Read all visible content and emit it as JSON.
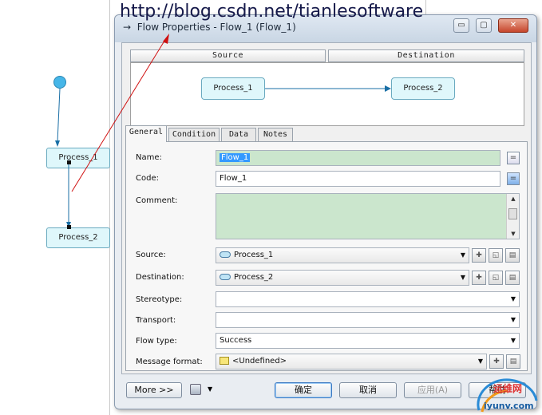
{
  "watermark": "http://blog.csdn.net/tianlesoftware",
  "background": {
    "nodes": [
      "Process_1",
      "Process_2"
    ]
  },
  "dialog": {
    "title": "Flow Properties - Flow_1 (Flow_1)",
    "title_icon": "→",
    "window_buttons": {
      "minimize": "▭",
      "maximize": "▢",
      "close": "✕"
    },
    "preview": {
      "source_header": "Source",
      "destination_header": "Destination",
      "source_node": "Process_1",
      "destination_node": "Process_2"
    },
    "tabs": [
      "General",
      "Condition",
      "Data",
      "Notes"
    ],
    "form": {
      "name_label": "Name:",
      "name_value": "Flow_1",
      "code_label": "Code:",
      "code_value": "Flow_1",
      "comment_label": "Comment:",
      "source_label": "Source:",
      "source_value": "Process_1",
      "destination_label": "Destination:",
      "destination_value": "Process_2",
      "stereotype_label": "Stereotype:",
      "transport_label": "Transport:",
      "flow_type_label": "Flow type:",
      "flow_type_value": "Success",
      "message_format_label": "Message format:",
      "message_format_value": "<Undefined>",
      "equals_button": "="
    },
    "buttons": {
      "more": "More >>",
      "ok": "确定",
      "cancel": "取消",
      "apply": "应用(A)",
      "help": "帮助"
    }
  },
  "logo": {
    "text_top": "运维网",
    "text_bottom": "iyunv.com"
  },
  "colors": {
    "accent": "#3399ff",
    "comment_bg": "#cbe6cd",
    "node_fill": "#dff7fb",
    "arrow": "#1a6fa6",
    "red_line": "#d01010"
  }
}
